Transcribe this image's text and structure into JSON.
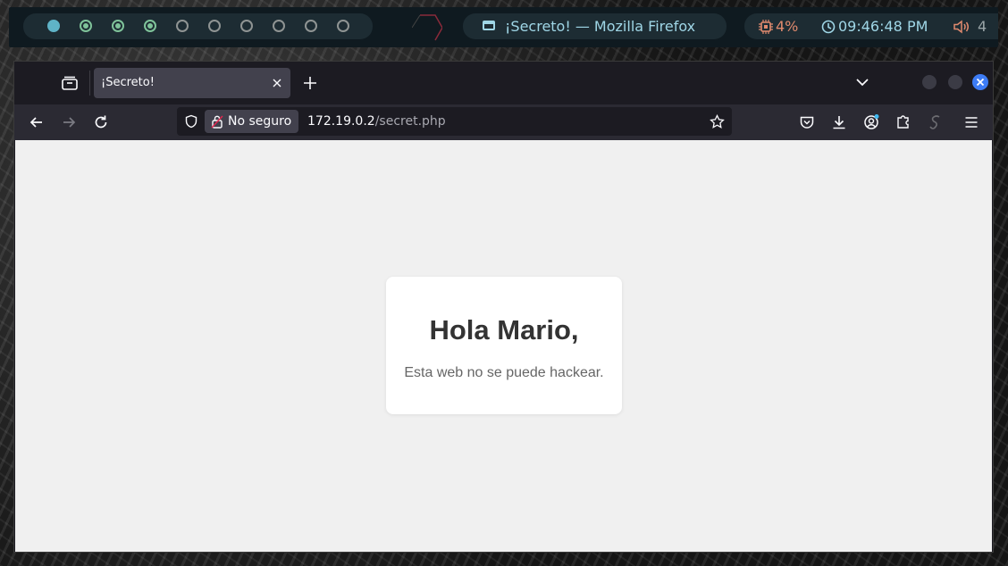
{
  "topbar": {
    "workspaces": [
      {
        "state": "active"
      },
      {
        "state": "occupied"
      },
      {
        "state": "occupied"
      },
      {
        "state": "occupied"
      },
      {
        "state": "empty"
      },
      {
        "state": "empty"
      },
      {
        "state": "empty"
      },
      {
        "state": "empty"
      },
      {
        "state": "empty"
      },
      {
        "state": "empty"
      }
    ],
    "window_title": "¡Secreto! — Mozilla Firefox",
    "cpu": "4%",
    "clock": "09:46:48 PM",
    "volume": "4",
    "colors": {
      "bar_bg": "#0f1a20",
      "pill_bg": "#1d2c33",
      "cyan": "#9fd6e6",
      "orange": "#e08a6e",
      "green": "#7fc39a",
      "active_ws": "#5fb3c7"
    }
  },
  "browser": {
    "tab": {
      "title": "¡Secreto!"
    },
    "urlbar": {
      "security_label": "No seguro",
      "host": "172.19.0.2",
      "path": "/secret.php"
    },
    "icons": [
      "tabs-icon",
      "close-tab-icon",
      "new-tab-icon",
      "list-all-tabs-icon",
      "back-icon",
      "forward-icon",
      "reload-icon",
      "shield-icon",
      "lock-icon",
      "star-icon",
      "pocket-icon",
      "download-icon",
      "account-icon",
      "extensions-icon",
      "extension-s-icon",
      "menu-icon"
    ],
    "colors": {
      "chrome_bg": "#1c1b22",
      "toolbar_bg": "#2b2a33",
      "tab_bg": "#42414d",
      "close_btn": "#3d7cf5"
    }
  },
  "page": {
    "heading": "Hola Mario,",
    "message": "Esta web no se puede hackear.",
    "colors": {
      "background": "#f0f0f0",
      "card": "#ffffff",
      "heading": "#333333",
      "message": "#666666"
    }
  }
}
